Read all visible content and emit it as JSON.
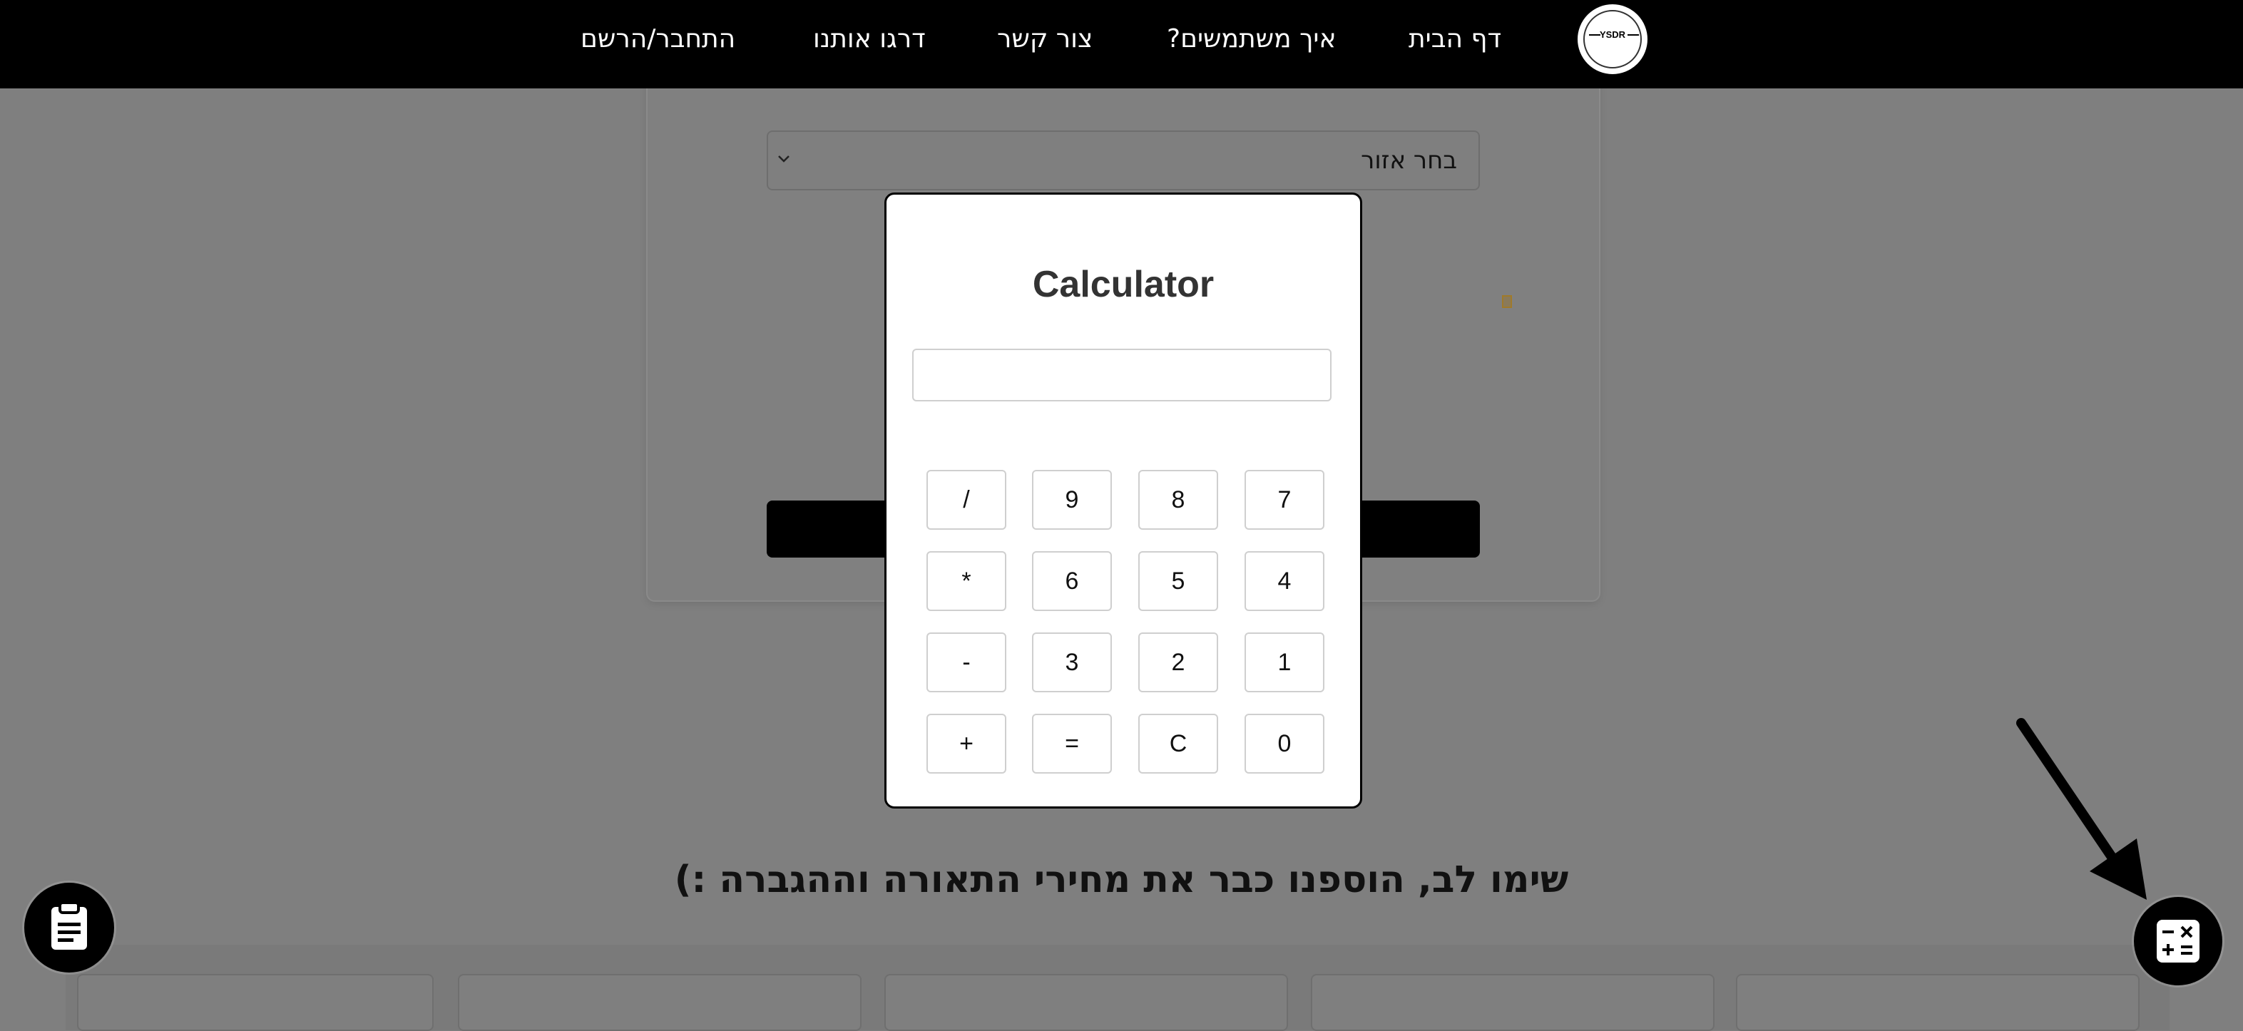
{
  "nav": {
    "logo_text": "YSDR",
    "items": [
      "דף הבית",
      "איך משתמשים?",
      "צור קשר",
      "דרגו אותנו",
      "התחבר/הרשם"
    ]
  },
  "form": {
    "region_placeholder": "בחר אזור"
  },
  "notice_text": "שימו לב, הוספנו כבר את מחירי התאורה וההגברה :)",
  "calculator": {
    "title": "Calculator",
    "display_value": "",
    "keys": [
      [
        "/",
        "9",
        "8",
        "7"
      ],
      [
        "*",
        "6",
        "5",
        "4"
      ],
      [
        "-",
        "3",
        "2",
        "1"
      ],
      [
        "+",
        "=",
        "C",
        "0"
      ]
    ]
  },
  "icons": {
    "notes_fab": "clipboard-icon",
    "calculator_fab": "calculator-icon"
  },
  "colors": {
    "navbar": "#000000",
    "overlay": "#7f7f7f",
    "modal": "#ffffff"
  }
}
